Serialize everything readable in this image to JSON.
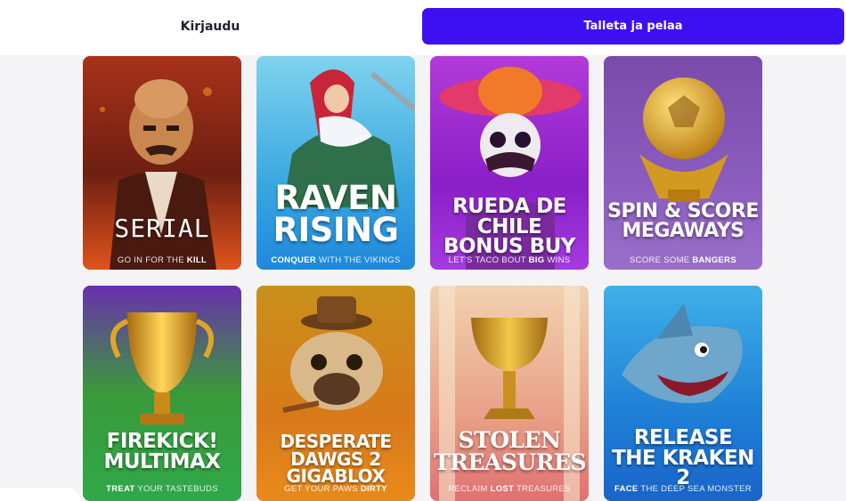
{
  "header": {
    "login_label": "Kirjaudu",
    "deposit_label": "Talleta ja pelaa",
    "accent_color": "#3d10f2"
  },
  "games": [
    {
      "title_lines": [
        "SERIAL"
      ],
      "tagline_pre": "GO IN FOR THE ",
      "tagline_bold": "KILL",
      "tagline_post": "",
      "theme": "serial"
    },
    {
      "title_lines": [
        "RAVEN",
        "RISING"
      ],
      "tagline_pre": "",
      "tagline_bold": "CONQUER",
      "tagline_post": " WITH THE VIKINGS",
      "theme": "raven"
    },
    {
      "title_lines": [
        "RUEDA DE CHILE",
        "BONUS BUY"
      ],
      "tagline_pre": "LET'S TACO BOUT ",
      "tagline_bold": "BIG",
      "tagline_post": " WINS",
      "theme": "rueda"
    },
    {
      "title_lines": [
        "SPIN & SCORE",
        "MEGAWAYS"
      ],
      "tagline_pre": "SCORE SOME ",
      "tagline_bold": "BANGERS",
      "tagline_post": "",
      "theme": "spin"
    },
    {
      "title_lines": [
        "FIREKICK!",
        "MULTIMAX"
      ],
      "tagline_pre": "",
      "tagline_bold": "TREAT",
      "tagline_post": " YOUR TASTEBUDS",
      "theme": "firekick"
    },
    {
      "title_lines": [
        "DESPERATE",
        "DAWGS 2 GIGABLOX"
      ],
      "tagline_pre": "GET YOUR PAWS ",
      "tagline_bold": "DIRTY",
      "tagline_post": "",
      "theme": "dawgs"
    },
    {
      "title_lines": [
        "STOLEN",
        "TREASURES"
      ],
      "tagline_pre": "RECLAIM ",
      "tagline_bold": "LOST",
      "tagline_post": " TREASURES",
      "theme": "stolen"
    },
    {
      "title_lines": [
        "RELEASE",
        "THE KRAKEN 2"
      ],
      "tagline_pre": "",
      "tagline_bold": "FACE",
      "tagline_post": " THE DEEP SEA MONSTER",
      "theme": "kraken"
    }
  ]
}
